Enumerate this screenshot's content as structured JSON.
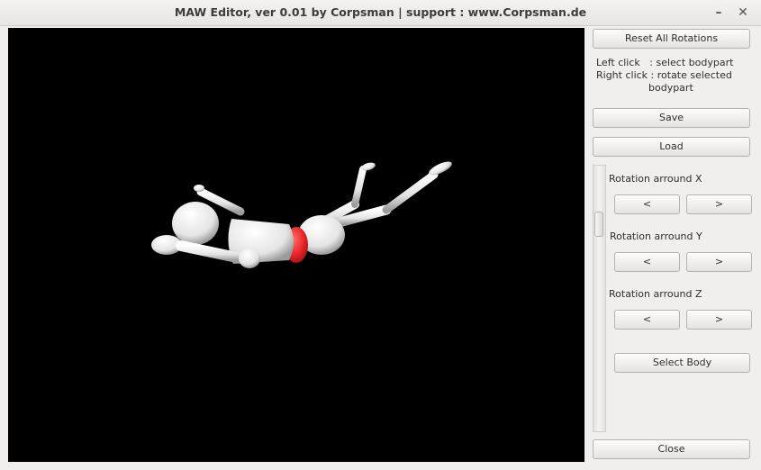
{
  "window": {
    "title": "MAW Editor, ver 0.01 by Corpsman | support : www.Corpsman.de",
    "minimize_glyph": "–",
    "close_glyph": "✕"
  },
  "viewport": {
    "background": "#000000",
    "figure_color": "#f2f2f2",
    "selected_part_color": "#e8262a",
    "selected_part": "hip"
  },
  "panel": {
    "reset_label": "Reset All Rotations",
    "help_lines": [
      "Left click   : select bodypart",
      "Right click : rotate selected",
      "bodypart"
    ],
    "save_label": "Save",
    "load_label": "Load",
    "rotation_x_label": "Rotation arround X",
    "rotation_y_label": "Rotation arround Y",
    "rotation_z_label": "Rotation arround Z",
    "prev_label": "<",
    "next_label": ">",
    "select_body_label": "Select Body",
    "close_label": "Close"
  }
}
